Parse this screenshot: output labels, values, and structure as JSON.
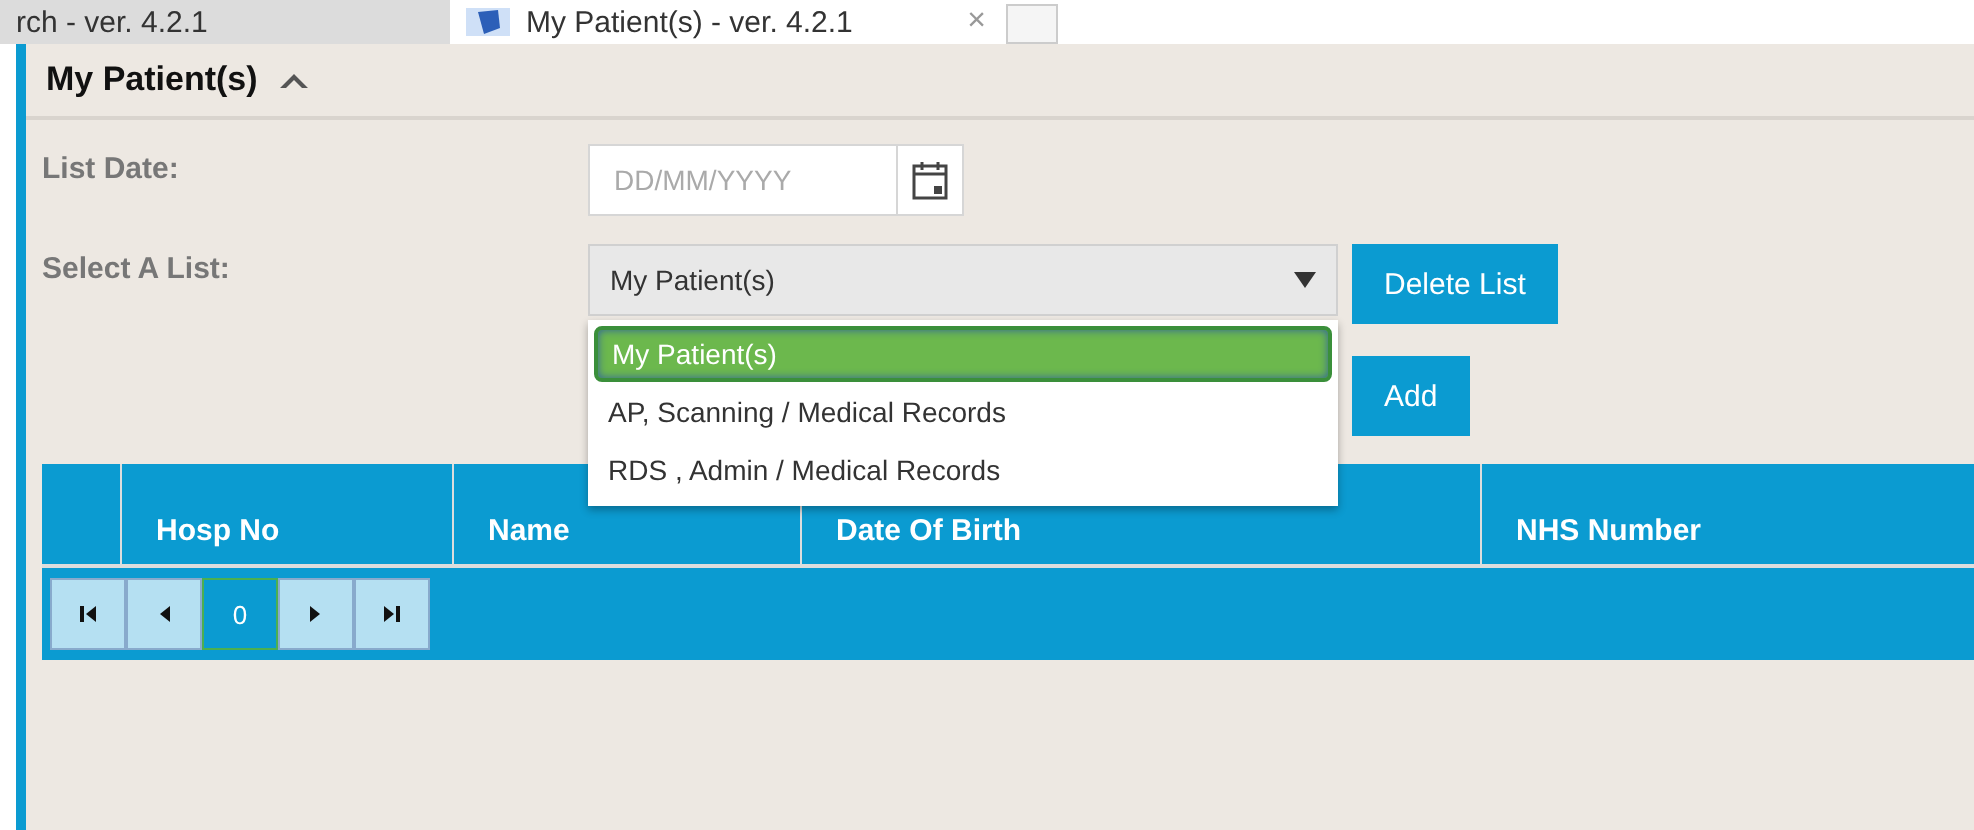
{
  "tabs": [
    {
      "label": "rch - ver. 4.2.1",
      "selected": false
    },
    {
      "label": "My Patient(s) - ver. 4.2.1",
      "selected": true,
      "close": "×"
    }
  ],
  "panel": {
    "title": "My Patient(s)",
    "expanded": true
  },
  "list_date": {
    "label": "List Date:",
    "placeholder": "DD/MM/YYYY"
  },
  "select_list": {
    "label": "Select A List:",
    "value": "My Patient(s)",
    "expanded": true,
    "options": [
      {
        "label": "My Patient(s)",
        "selected": true
      },
      {
        "label": "AP, Scanning / Medical Records",
        "selected": false
      },
      {
        "label": "RDS , Admin / Medical Records",
        "selected": false
      }
    ]
  },
  "buttons": [
    "Delete List",
    "Add"
  ],
  "table": {
    "columns": [
      "",
      "Hosp No",
      "Name",
      "Date Of Birth",
      "NHS Number"
    ]
  },
  "pager": {
    "page": "0"
  }
}
